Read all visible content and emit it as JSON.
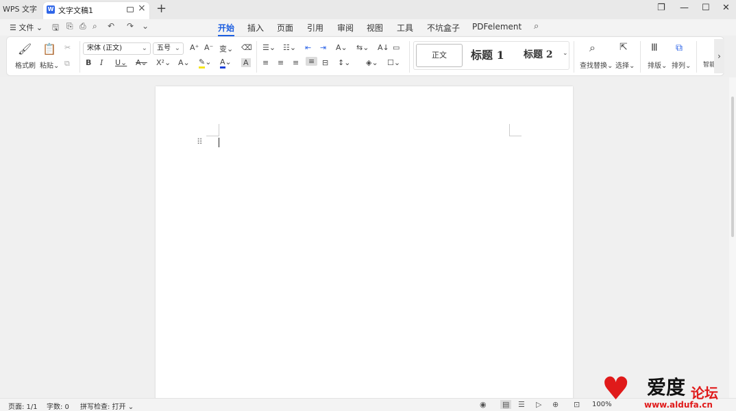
{
  "app_tab": "WPS 文字",
  "doc_tab": {
    "title": "文字文稿1",
    "logo": "W"
  },
  "menubar": {
    "file": "文件",
    "items": [
      "开始",
      "插入",
      "页面",
      "引用",
      "审阅",
      "视图",
      "工具",
      "不坑盒子",
      "PDFelement"
    ],
    "active": "开始"
  },
  "ribbon": {
    "format_painter": "格式刷",
    "paste": "粘贴",
    "font_name": "宋体 (正文)",
    "font_size": "五号",
    "styles": {
      "normal": "正文",
      "heading1": "标题 1",
      "heading2": "标题 2"
    },
    "find_replace": "查找替换",
    "select": "选择",
    "layout": "排版",
    "arrange": "排列",
    "smart": "智能"
  },
  "status": {
    "page": "页面: 1/1",
    "words": "字数: 0",
    "spell": "拼写检查: 打开",
    "zoom": "100%"
  },
  "watermark": {
    "main": "爱度",
    "sub": "论坛",
    "url": "www.aldufa.cn"
  },
  "colors": {
    "accent": "#1a5de0",
    "font_color": "#1a3fd8",
    "highlight": "#f5e51a"
  }
}
